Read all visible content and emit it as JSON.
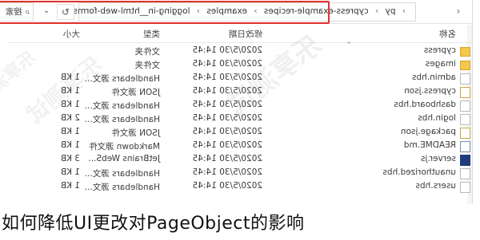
{
  "toolbar": {
    "search_label": "搜索",
    "back_symbol": "‹",
    "refresh_symbol": "↻",
    "dropdown_symbol": "⌄",
    "root_crumb": "py",
    "crumbs": [
      "cypress-example-recipes",
      "examples",
      "logging-in__html-web-forms"
    ]
  },
  "columns": {
    "name": "名称",
    "date": "修改日期",
    "type": "类型",
    "size": "大小"
  },
  "files": [
    {
      "name": "cypress",
      "date": "2020/5/30 14:45",
      "type": "文件夹",
      "size": "",
      "icon": "folder-icon"
    },
    {
      "name": "images",
      "date": "2020/5/30 14:45",
      "type": "文件夹",
      "size": "",
      "icon": "folder-icon"
    },
    {
      "name": "admin.hbs",
      "date": "2020/5/30 14:45",
      "type": "Handlebars 源文...",
      "size": "1 KB",
      "icon": "file-icon"
    },
    {
      "name": "cypress.json",
      "date": "2020/5/30 14:45",
      "type": "JSON 源文件",
      "size": "1 KB",
      "icon": "json-file-icon"
    },
    {
      "name": "dashboard.hbs",
      "date": "2020/5/30 14:45",
      "type": "Handlebars 源文...",
      "size": "1 KB",
      "icon": "file-icon"
    },
    {
      "name": "login.hbs",
      "date": "2020/5/30 14:45",
      "type": "Handlebars 源文...",
      "size": "2 KB",
      "icon": "file-icon"
    },
    {
      "name": "package.json",
      "date": "2020/5/30 14:45",
      "type": "JSON 源文件",
      "size": "1 KB",
      "icon": "json-file-icon"
    },
    {
      "name": "README.md",
      "date": "2020/5/30 14:45",
      "type": "Markdown 源文件",
      "size": "1 KB",
      "icon": "markdown-file-icon"
    },
    {
      "name": "server.js",
      "date": "2020/5/30 14:45",
      "type": "JetBrains WebS...",
      "size": "3 KB",
      "icon": "webstorm-file-icon"
    },
    {
      "name": "unauthorized.hbs",
      "date": "2020/5/30 14:45",
      "type": "Handlebars 源文...",
      "size": "1 KB",
      "icon": "file-icon"
    },
    {
      "name": "users.hbs",
      "date": "2020/5/30 14:45",
      "type": "Handlebars 源文...",
      "size": "1 KB",
      "icon": "file-icon"
    }
  ],
  "watermark": "乐享测试",
  "caption": "如何降低UI更改对PageObject的影响",
  "colors": {
    "highlight": "#e3302f",
    "folder": "#f3c84b"
  }
}
